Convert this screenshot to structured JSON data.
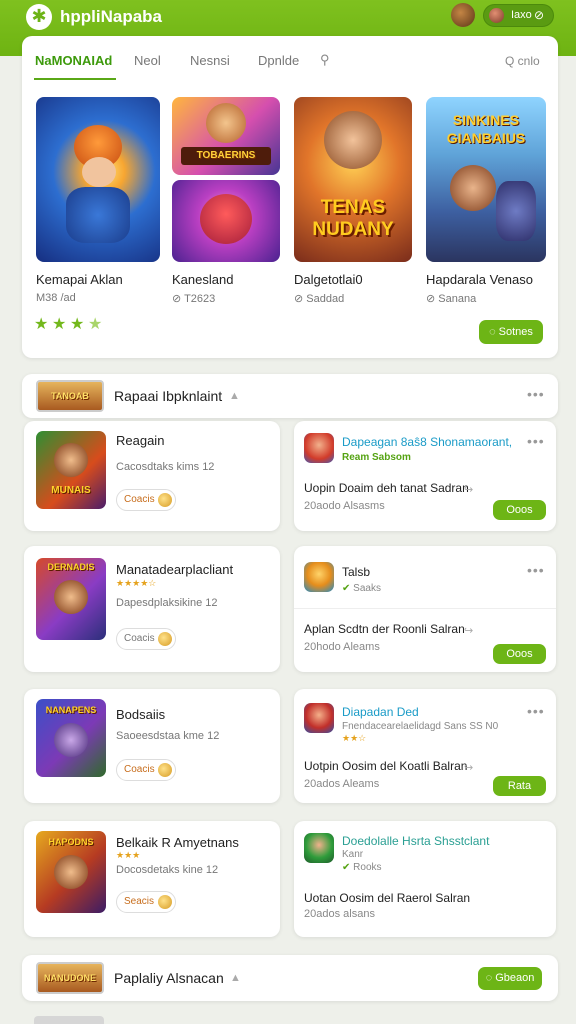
{
  "header": {
    "brand": "hppliNapaba",
    "logo_icon": "✱",
    "user_name": "Iaxo",
    "user_icon": "⊘"
  },
  "tabs": [
    {
      "label": "NaMONAIAd",
      "active": true
    },
    {
      "label": "Neol"
    },
    {
      "label": "Nesnsi"
    },
    {
      "label": "Dpnlde"
    }
  ],
  "search": {
    "icon": "search-icon",
    "label": "Q cnlo"
  },
  "featured": [
    {
      "title": "Kemapai Aklan",
      "sub": "M38 /ad",
      "stars": 4
    },
    {
      "title": "Kanesland",
      "sub": "⊘ T2623"
    },
    {
      "title": "Dalgetotlai0",
      "sub": "⊘ Saddad",
      "art_text": "TENAS NUDANY"
    },
    {
      "title": "Hapdarala Venaso",
      "sub": "⊘ Sanana",
      "art_text": "SINKINES GIANBAIUS"
    }
  ],
  "featured_button": "Sotnes",
  "art_labels": {
    "a2": "TOBAERINS"
  },
  "section1": {
    "thumb_text": "TANOAB",
    "title": "Rapaai Ibpknlaint"
  },
  "left_items": [
    {
      "title": "Reagain",
      "sub": "Cacosdtaks kims 12",
      "btn": "Coacis",
      "thumb_text": "MUNAIS"
    },
    {
      "title": "Manatadearplacliant",
      "sub": "Dapesdplaksikine 12",
      "btn": "Coacis",
      "thumb_text": "DERNADIS",
      "stars": "★★★★☆"
    },
    {
      "title": "Bodsaiis",
      "sub": "Saoeesdstaa kme 12",
      "btn": "Coacis",
      "thumb_text": "NANAPENS"
    },
    {
      "title": "Belkaik R Amyetnans",
      "sub": "Docosdetaks kine 12",
      "btn": "Seacis",
      "thumb_text": "HAPODNS",
      "stars": "★★★"
    }
  ],
  "right_items": [
    {
      "title": "Dapeagan 8aŝ8 Shonamaorant,",
      "sub": "Ream Sabsom",
      "desc": "Uopin Doaim deh tanat Sadran",
      "meta": "20aodo Alsasms",
      "btn": "Ooos"
    },
    {
      "title": "Talsb",
      "sub": "Saaks",
      "desc": "Aplan Scdtn der Roonli Salran",
      "meta": "20hodo Aleams",
      "btn": "Ooos",
      "title_dark": true
    },
    {
      "title": "Diapadan Ded",
      "sub": "Fnendacearelaelidagd Sans SS N0",
      "desc": "Uotpin Oosim del Koatli Balran",
      "meta": "20ados Aleams",
      "btn": "Rata",
      "stars": "★★☆"
    },
    {
      "title": "Doedolalle Hsrta Shsstclant",
      "sub": "Kanr",
      "sub2": "Rooks",
      "desc": "Uotan Oosim del Raerol Salran",
      "meta": "20ados alsans"
    }
  ],
  "section2": {
    "thumb_text": "NANUDONE",
    "title": "Paplaliy Alsnacan",
    "btn": "Gbeaon"
  },
  "colors": {
    "brand_green": "#6db516",
    "link_blue": "#1a9bc7"
  }
}
